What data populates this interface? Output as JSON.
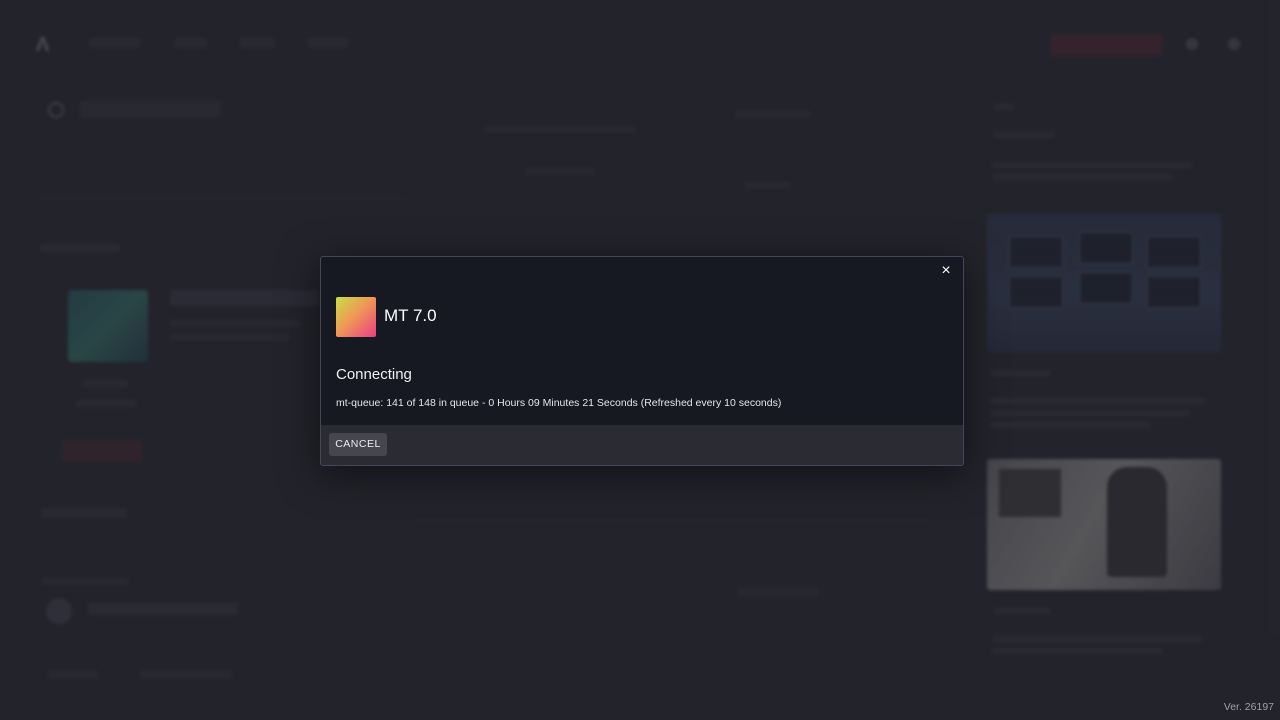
{
  "modal": {
    "title": "MT 7.0",
    "status": "Connecting",
    "queue_text": "mt-queue: 141 of 148 in queue - 0 Hours 09 Minutes 21 Seconds (Refreshed every 10 seconds)",
    "cancel_label": "CANCEL",
    "close_glyph": "×",
    "icon_gradient": [
      "#c8df46",
      "#ef9a54",
      "#ea3f84"
    ]
  },
  "footer": {
    "version": "Ver. 26197"
  },
  "colors": {
    "background": "#2a2b34",
    "modal_body": "#161822",
    "modal_footer": "#2a2b33",
    "button": "#45464f"
  }
}
